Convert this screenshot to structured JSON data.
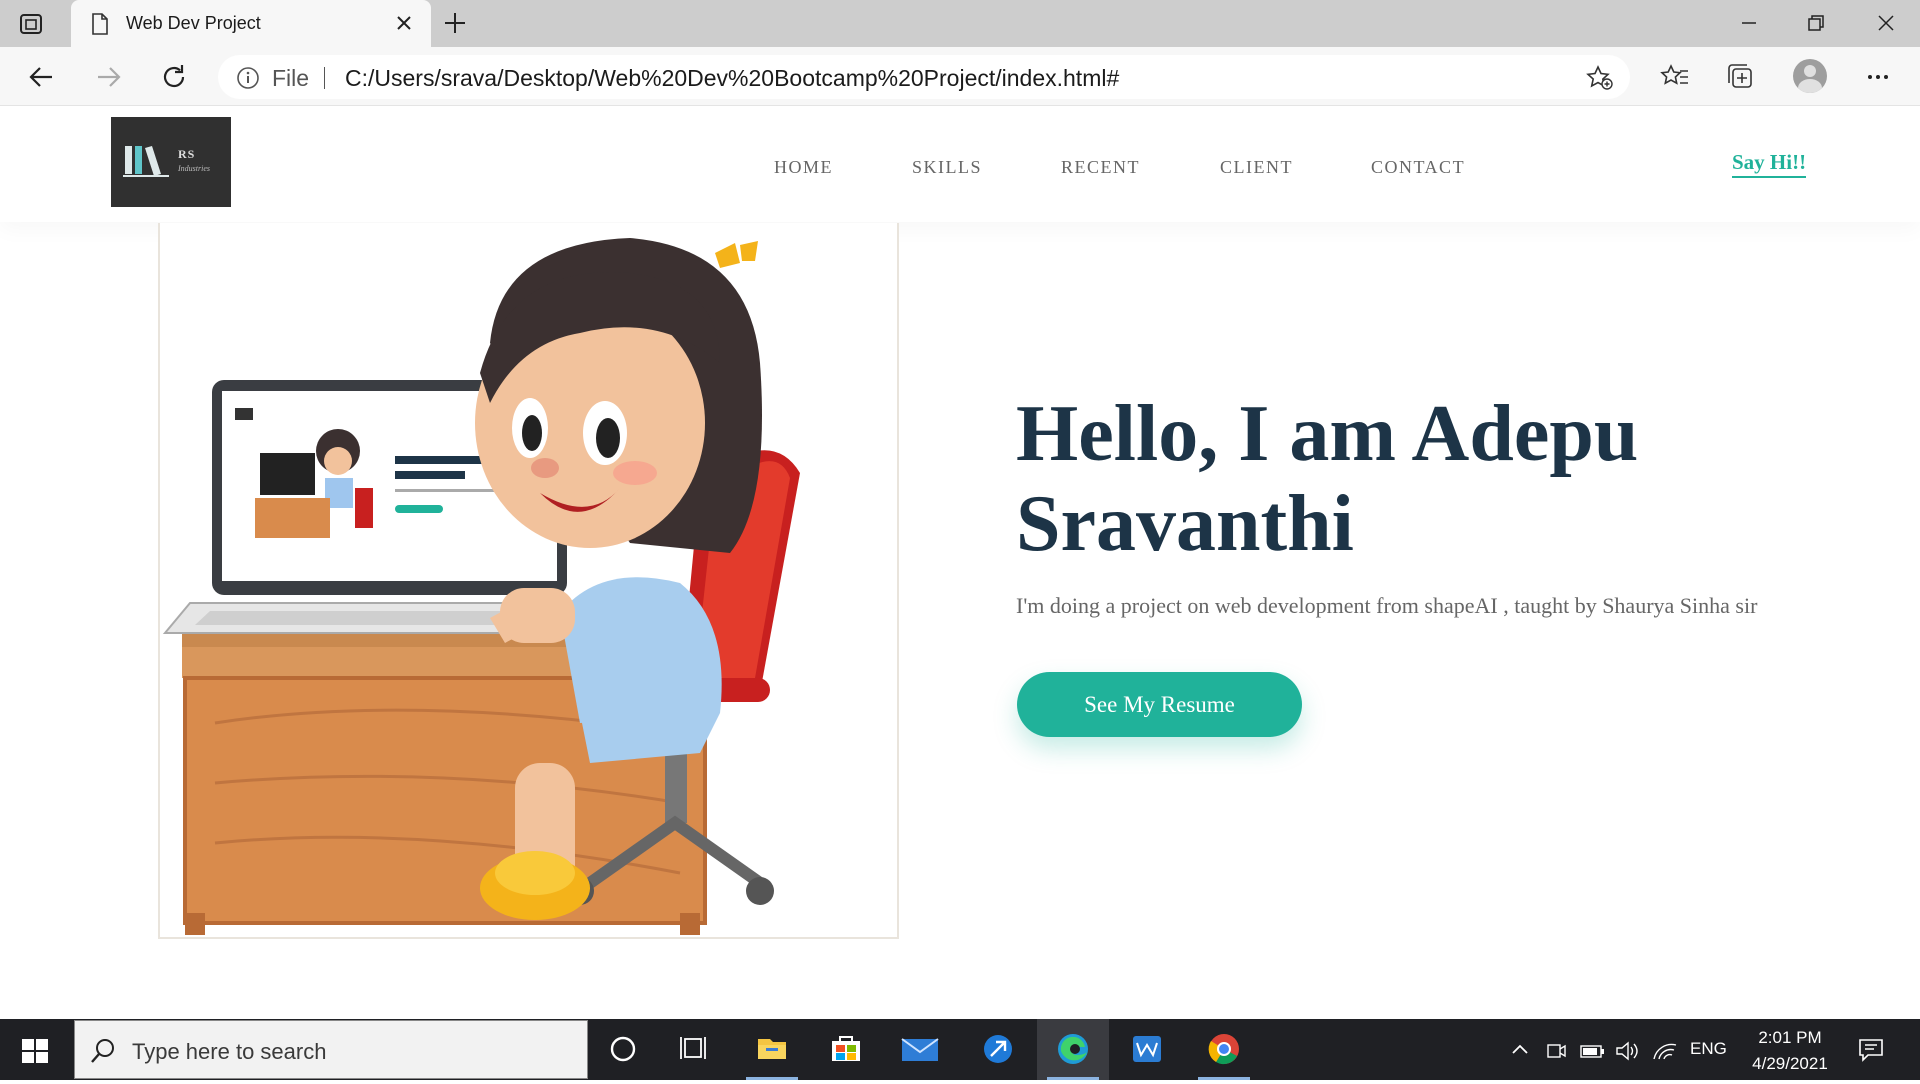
{
  "browser": {
    "tab_title": "Web Dev Project",
    "address_scheme": "File",
    "url": "C:/Users/srava/Desktop/Web%20Dev%20Bootcamp%20Project/index.html#"
  },
  "site": {
    "logo": {
      "title": "RS",
      "subtitle": "Industries"
    },
    "nav": [
      {
        "label": "HOME"
      },
      {
        "label": "SKILLS"
      },
      {
        "label": "RECENT"
      },
      {
        "label": "CLIENT"
      },
      {
        "label": "CONTACT"
      }
    ],
    "cta_link": "Say Hi!!",
    "hero": {
      "title": "Hello, I am Adepu Sravanthi",
      "description": "I'm doing a project on web development from shapeAI , taught by Shaurya Sinha sir",
      "button": "See My Resume"
    },
    "colors": {
      "accent": "#20b29a",
      "heading": "#1d3447",
      "text": "#666666"
    }
  },
  "taskbar": {
    "search_placeholder": "Type here to search",
    "apps": [
      "cortana-icon",
      "task-view-icon",
      "file-explorer-icon",
      "store-icon",
      "mail-icon",
      "app-icon",
      "edge-icon",
      "word-icon",
      "chrome-icon"
    ],
    "tray": {
      "language": "ENG",
      "time": "2:01 PM",
      "date": "4/29/2021"
    }
  }
}
